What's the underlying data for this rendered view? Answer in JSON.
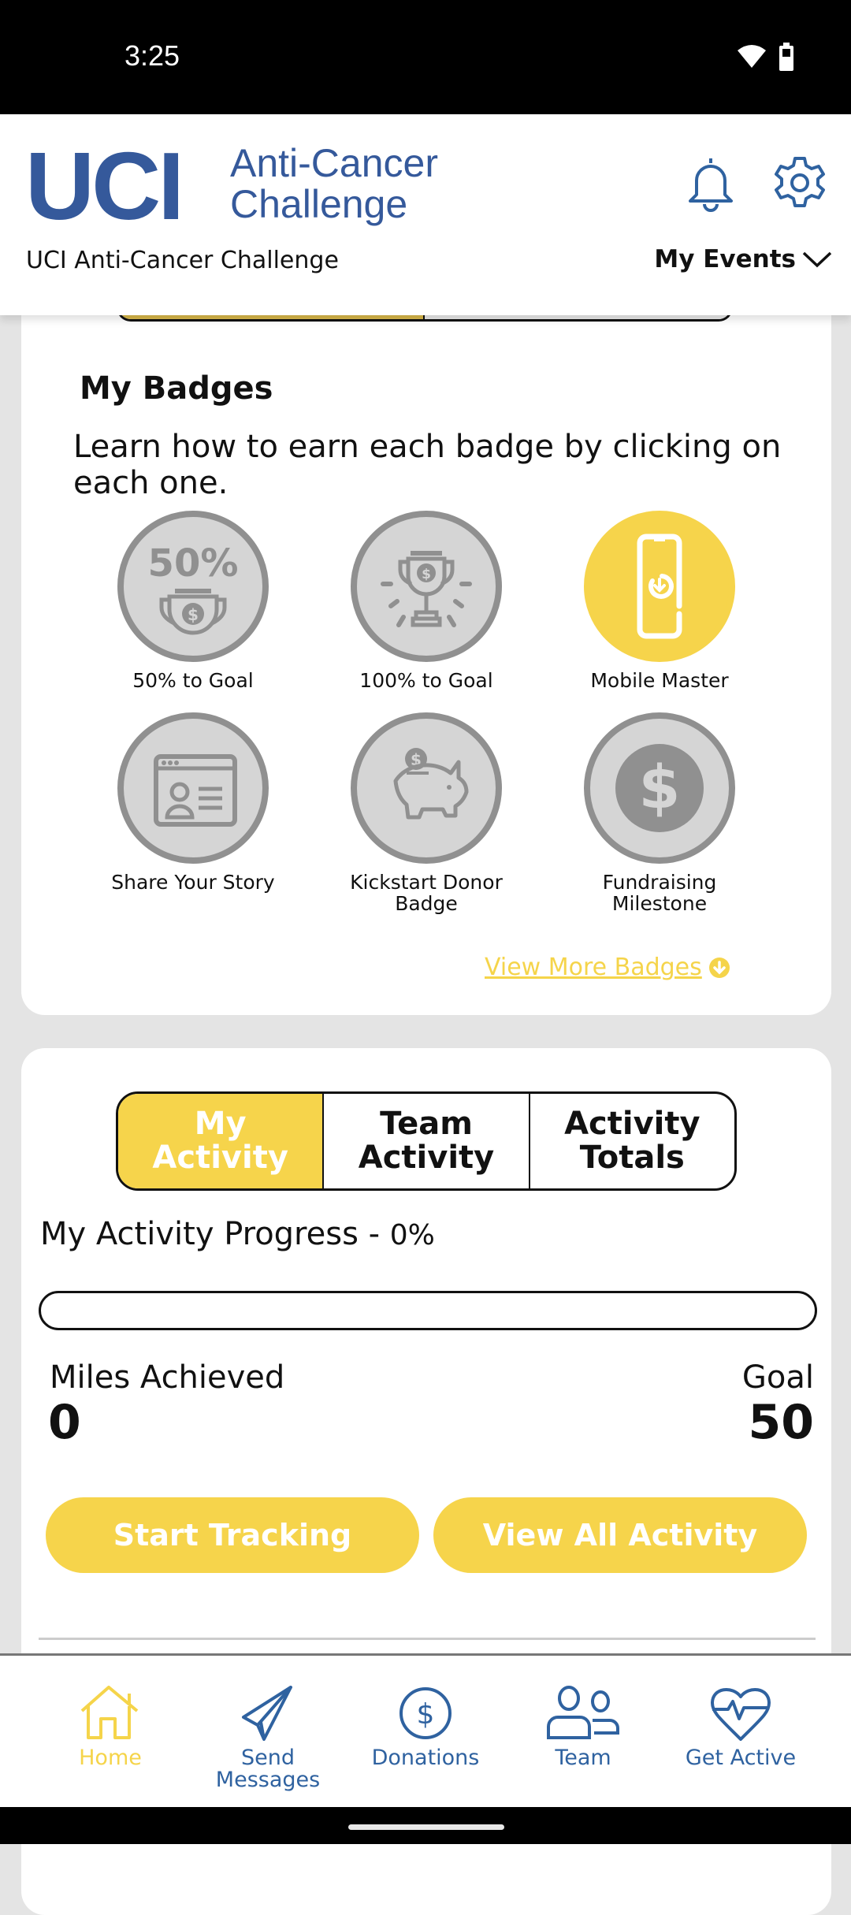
{
  "status_bar": {
    "time": "3:25",
    "icons": [
      "wifi-icon",
      "battery-icon"
    ]
  },
  "header": {
    "logo_main": "UCI",
    "logo_sub_line1": "Anti-Cancer",
    "logo_sub_line2": "Challenge",
    "event_title": "UCI Anti-Cancer Challenge",
    "events_dropdown": "My Events",
    "icons": [
      "bell-icon",
      "gear-icon"
    ]
  },
  "badges": {
    "title": "My Badges",
    "description": "Learn how to earn each badge by clicking on each one.",
    "items": [
      {
        "label": "50% to Goal",
        "icon": "fifty-percent-trophy-icon",
        "earned": false
      },
      {
        "label": "100% to Goal",
        "icon": "trophy-icon",
        "earned": false
      },
      {
        "label": "Mobile Master",
        "icon": "mobile-download-icon",
        "earned": true
      },
      {
        "label": "Share Your Story",
        "icon": "profile-card-icon",
        "earned": false
      },
      {
        "label": "Kickstart Donor Badge",
        "icon": "piggy-bank-icon",
        "earned": false
      },
      {
        "label": "Fundraising Milestone",
        "icon": "dollar-coin-icon",
        "earned": false
      }
    ],
    "view_more": "View More Badges"
  },
  "activity": {
    "tabs": [
      {
        "label": "My Activity",
        "active": true
      },
      {
        "label": "Team Activity",
        "active": false
      },
      {
        "label": "Activity Totals",
        "active": false
      }
    ],
    "progress_label": "My Activity Progress - ",
    "progress_pct_text": "0%",
    "progress_fraction": 0,
    "miles_label": "Miles Achieved",
    "miles_value": "0",
    "goal_label": "Goal",
    "goal_value": "50",
    "start_tracking": "Start Tracking",
    "view_all": "View All Activity"
  },
  "bottom_nav": [
    {
      "label": "Home",
      "icon": "home-icon",
      "active": true
    },
    {
      "label": "Send Messages",
      "icon": "paper-plane-icon",
      "active": false
    },
    {
      "label": "Donations",
      "icon": "dollar-circle-icon",
      "active": false
    },
    {
      "label": "Team",
      "icon": "team-icon",
      "active": false
    },
    {
      "label": "Get Active",
      "icon": "heartbeat-icon",
      "active": false
    }
  ],
  "colors": {
    "brand_blue": "#35599b",
    "accent_yellow": "#f6d44b",
    "badge_gray": "#909090"
  }
}
